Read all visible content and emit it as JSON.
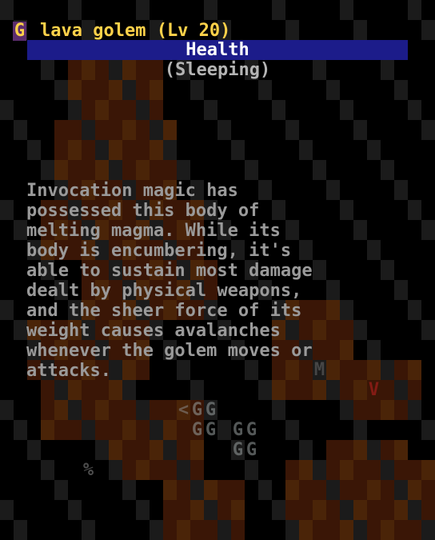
{
  "monster": {
    "glyph": "G",
    "name": "lava golem (Lv 20)",
    "health_label": "Health",
    "health_fraction": 1.0,
    "status": "(Sleeping)",
    "description": "Invocation magic has\npossessed this body of\nmelting magma. While its\nbody is encumbering, it's\nable to sustain most damage\ndealt by physical weapons,\nand the sheer force of its\nweight causes avalanches\nwhenever the golem moves or\nattacks."
  },
  "colors": {
    "title": "#ffd24a",
    "glyph": "#ffd24a",
    "glyph_bg": "#5c2d6e",
    "health_bar": "#1c1c8a",
    "health_text": "#ffffff",
    "status": "#b4b4b4",
    "description": "#9a9a9a",
    "lava_dark": "#3a1606",
    "lava_mid": "#4a2408",
    "rock": "#1b1b1b"
  },
  "map_glyphs": [
    {
      "char": "G",
      "color": "#9aa0a0",
      "name": "golem-glyph"
    },
    {
      "char": "<",
      "color": "#8a8a8a",
      "name": "upstairs-glyph"
    },
    {
      "char": "M",
      "color": "#6a6a6a",
      "name": "monster-m-glyph"
    },
    {
      "char": "V",
      "color": "#c02020",
      "name": "monster-v-glyph"
    },
    {
      "char": "%",
      "color": "#8a8a8a",
      "name": "item-glyph"
    }
  ]
}
